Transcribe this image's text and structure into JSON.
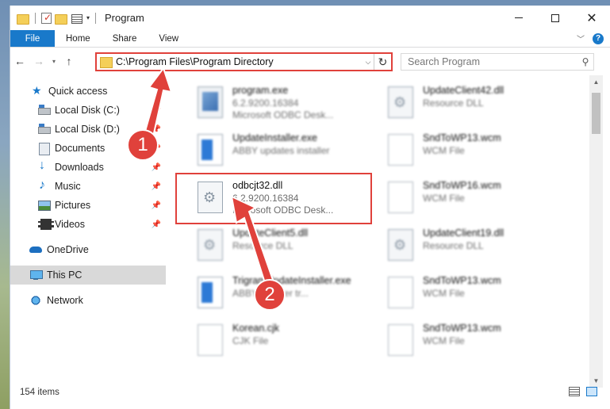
{
  "window": {
    "title": "Program",
    "controls": {
      "minimize": "minimize-icon",
      "maximize": "maximize-icon",
      "close": "close-icon"
    }
  },
  "ribbon": {
    "tabs": [
      "File",
      "Home",
      "Share",
      "View"
    ]
  },
  "address": {
    "path": "C:\\Program Files\\Program Directory",
    "search_placeholder": "Search Program"
  },
  "nav": {
    "items": [
      {
        "label": "Quick access",
        "icon": "star-icon"
      },
      {
        "label": "Local Disk (C:)",
        "icon": "disk-icon"
      },
      {
        "label": "Local Disk (D:)",
        "icon": "disk-icon"
      },
      {
        "label": "Documents",
        "icon": "document-icon"
      },
      {
        "label": "Downloads",
        "icon": "download-icon"
      },
      {
        "label": "Music",
        "icon": "music-icon"
      },
      {
        "label": "Pictures",
        "icon": "picture-icon"
      },
      {
        "label": "Videos",
        "icon": "video-icon"
      },
      {
        "label": "OneDrive",
        "icon": "cloud-icon"
      },
      {
        "label": "This PC",
        "icon": "pc-icon"
      },
      {
        "label": "Network",
        "icon": "network-icon"
      }
    ]
  },
  "files": [
    {
      "name": "program.exe",
      "l1": "6.2.9200.16384",
      "l2": "Microsoft ODBC Desk..."
    },
    {
      "name": "UpdateClient42.dll",
      "l1": "Resource DLL",
      "l2": ""
    },
    {
      "name": "UpdateInstaller.exe",
      "l1": "ABBY updates installer",
      "l2": ""
    },
    {
      "name": "SndToWP13.wcm",
      "l1": "WCM File",
      "l2": ""
    },
    {
      "name": "odbcjt32.dll",
      "l1": "6.2.9200.16384",
      "l2": "Microsoft ODBC Desk..."
    },
    {
      "name": "SndToWP16.wcm",
      "l1": "WCM File",
      "l2": ""
    },
    {
      "name": "UpdateClient5.dll",
      "l1": "Resource DLL",
      "l2": ""
    },
    {
      "name": "UpdateClient19.dll",
      "l1": "Resource DLL",
      "l2": ""
    },
    {
      "name": "TrigramUpdateInstaller.exe",
      "l1": "ABBY updater tr...",
      "l2": ""
    },
    {
      "name": "SndToWP13.wcm",
      "l1": "WCM File",
      "l2": ""
    },
    {
      "name": "Korean.cjk",
      "l1": "CJK File",
      "l2": ""
    },
    {
      "name": "SndToWP13.wcm",
      "l1": "WCM File",
      "l2": ""
    }
  ],
  "status": {
    "count": "154 items"
  },
  "callouts": [
    "1",
    "2"
  ],
  "colors": {
    "accent": "#1979ca",
    "highlight": "#e0413b"
  }
}
